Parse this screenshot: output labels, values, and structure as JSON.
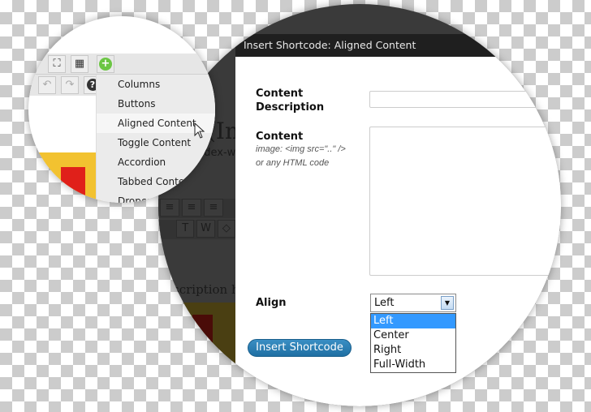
{
  "background_editor": {
    "heading_fragment": "(Im",
    "filename_fragment": "ndex-w",
    "description_fragment": "scription he",
    "toolbar_icons": [
      "align-left-icon",
      "align-center-icon",
      "align-right-icon",
      "paste-text-icon",
      "paste-word-icon",
      "eraser-icon"
    ]
  },
  "toolbar": {
    "icons": [
      "fullscreen-icon",
      "keyboard-icon",
      "add-shortcode-icon",
      "undo-icon",
      "redo-icon",
      "help-icon"
    ]
  },
  "shortcode_menu": {
    "items": [
      "Columns",
      "Buttons",
      "Aligned Content",
      "Toggle Content",
      "Accordion",
      "Tabbed Content",
      "Dropcap"
    ],
    "hovered": "Aligned Content"
  },
  "dialog": {
    "title": "Insert Shortcode: Aligned Content",
    "fields": {
      "content_description_label": "Content Description",
      "content_description_value": "",
      "content_label": "Content",
      "content_hint": "image: <img src=\"..\" /> or any HTML code",
      "content_value": "",
      "align_label": "Align",
      "align_selected": "Left",
      "align_options": [
        "Left",
        "Center",
        "Right",
        "Full-Width"
      ]
    },
    "insert_button": "Insert Shortcode"
  },
  "colors": {
    "accent": "#2479ad",
    "selection": "#3399ff",
    "add_icon": "#6cc644"
  }
}
